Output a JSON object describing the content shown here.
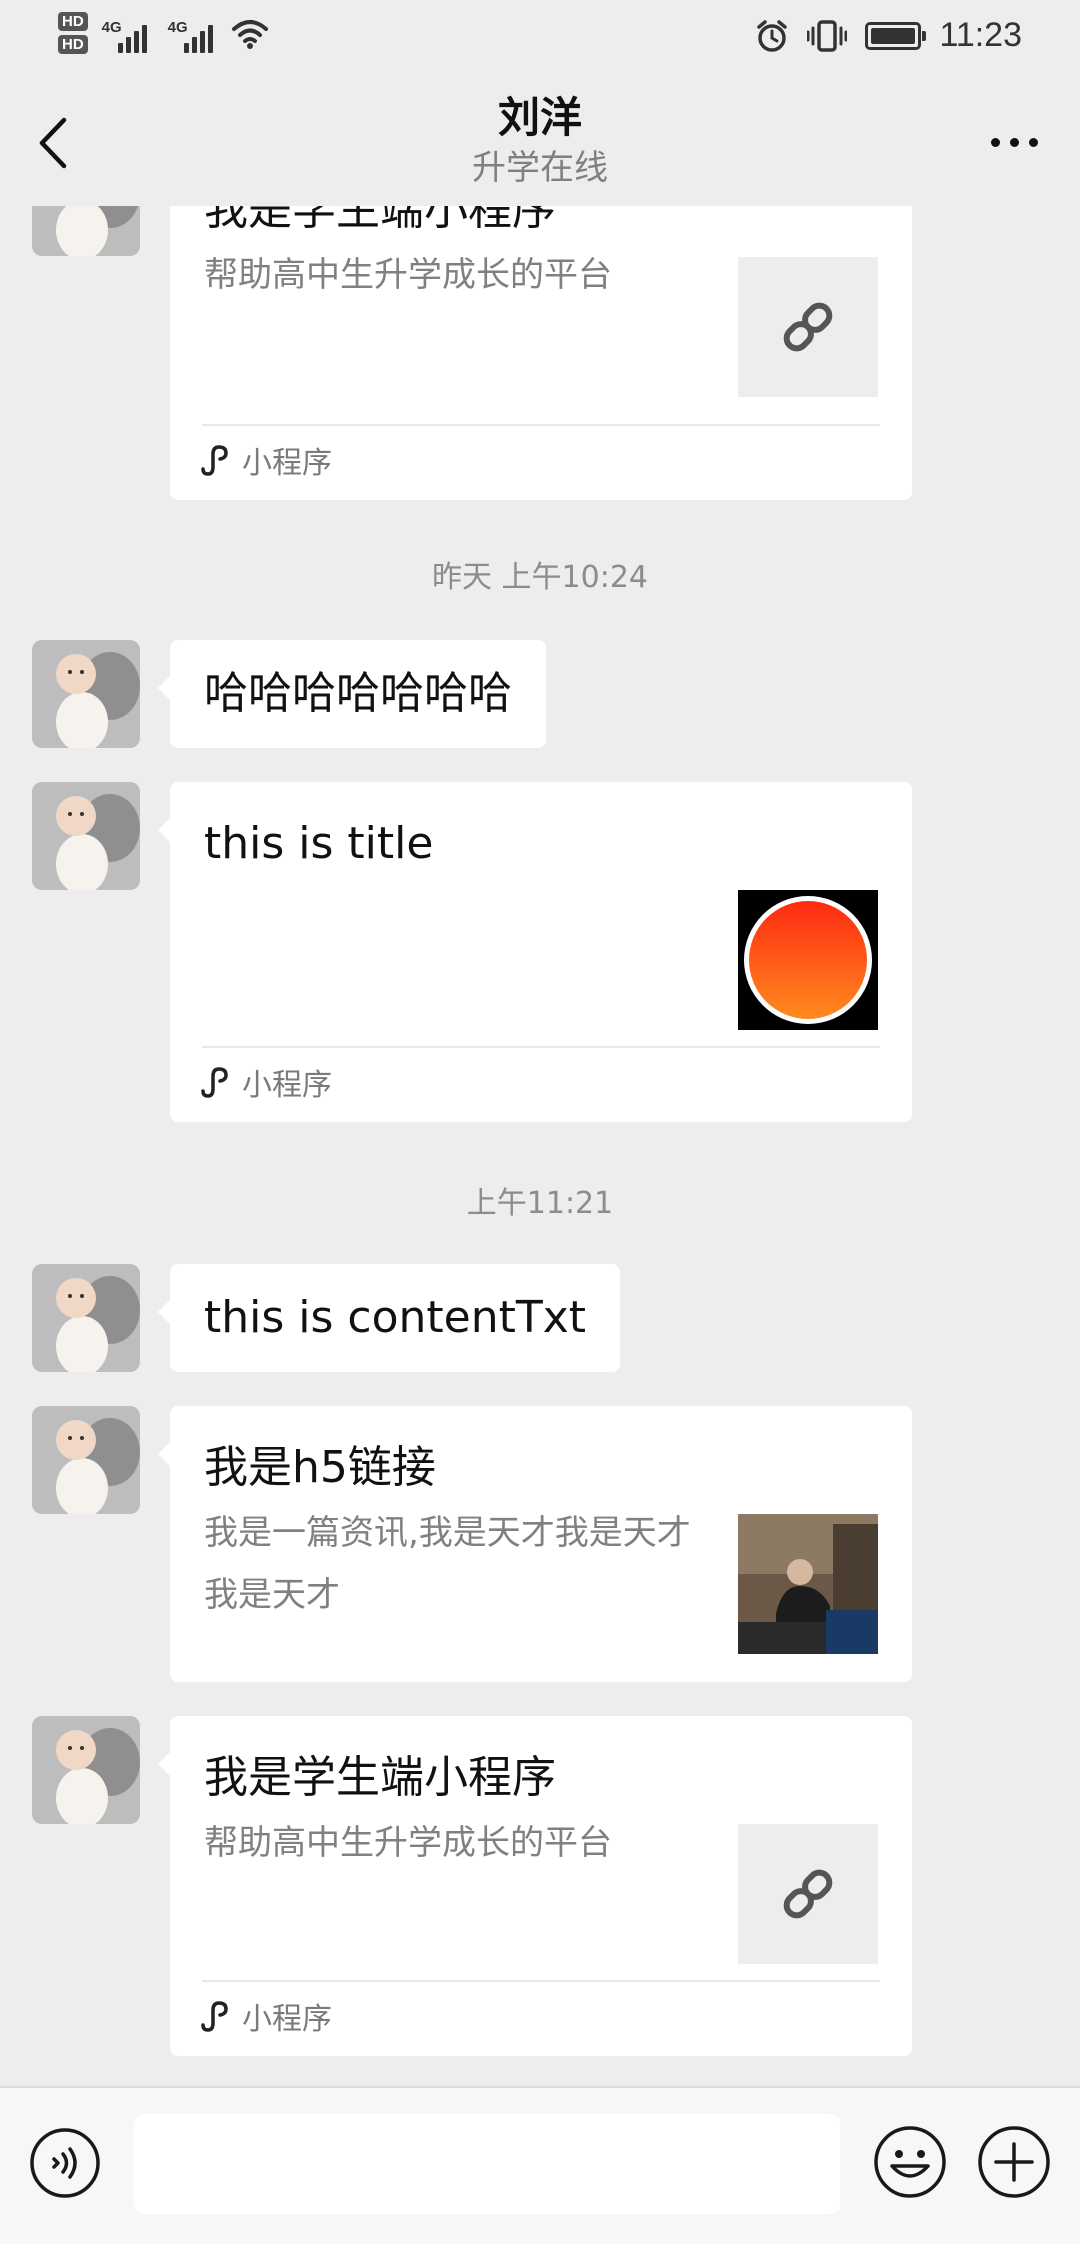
{
  "status_bar": {
    "hd1": "HD",
    "hd2": "HD",
    "net1": "4G",
    "net2": "4G",
    "time": "11:23"
  },
  "header": {
    "title": "刘洋",
    "subtitle": "升学在线"
  },
  "messages": {
    "card_top": {
      "title": "我是学生端小程序",
      "desc": "帮助高中生升学成长的平台",
      "footer": "小程序"
    },
    "time1": "昨天 上午10:24",
    "text1": "哈哈哈哈哈哈哈",
    "card_title": {
      "title": "this is title",
      "footer": "小程序"
    },
    "time2": "上午11:21",
    "text2": "this is contentTxt",
    "card_h5": {
      "title": "我是h5链接",
      "desc": "我是一篇资讯,我是天才我是天才我是天才"
    },
    "card_bottom": {
      "title": "我是学生端小程序",
      "desc": "帮助高中生升学成长的平台",
      "footer": "小程序"
    }
  },
  "input": {
    "value": ""
  },
  "icons": {
    "back": "chevron-left-icon",
    "more": "more-icon",
    "link": "link-icon",
    "miniprogram": "miniprogram-icon",
    "voice": "voice-icon",
    "emoji": "emoji-icon",
    "plus": "plus-icon"
  },
  "colors": {
    "background": "#ededed",
    "bubble": "#ffffff",
    "timestamp": "#8c8c8c",
    "orange_thumb": "#ff5a14"
  }
}
